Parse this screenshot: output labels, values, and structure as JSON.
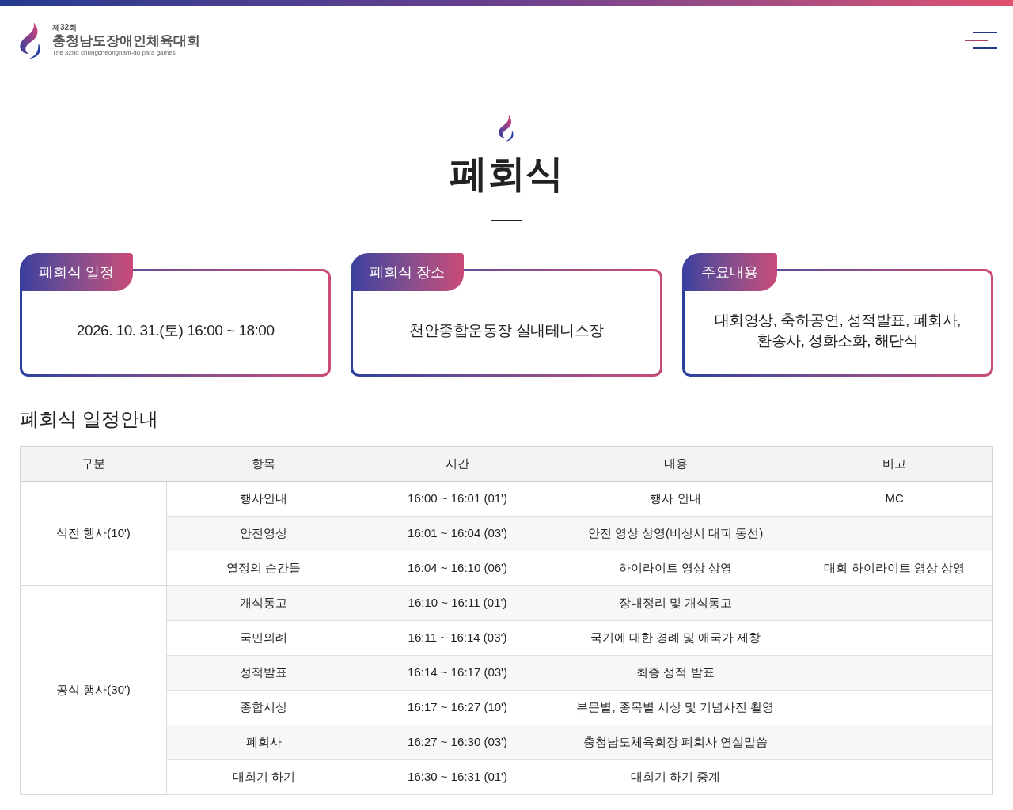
{
  "header": {
    "logo": {
      "edition": "제32회",
      "name": "충청남도장애인체육대회",
      "english": "The 32nd chungcheongnam-do para games"
    }
  },
  "page_title": "폐회식",
  "info_cards": [
    {
      "label": "폐회식 일정",
      "text": "2026. 10. 31.(토) 16:00 ~ 18:00"
    },
    {
      "label": "폐회식 장소",
      "text": "천안종합운동장 실내테니스장"
    },
    {
      "label": "주요내용",
      "text": "대회영상, 축하공연, 성적발표, 폐회사, 환송사, 성화소화, 해단식"
    }
  ],
  "schedule": {
    "title": "폐회식 일정안내",
    "columns": [
      "구분",
      "항목",
      "시간",
      "내용",
      "비고"
    ],
    "groups": [
      {
        "name": "식전 행사(10')",
        "rows": [
          {
            "item": "행사안내",
            "time": "16:00 ~ 16:01 (01')",
            "content": "행사 안내",
            "note": "MC"
          },
          {
            "item": "안전영상",
            "time": "16:01 ~ 16:04 (03')",
            "content": "안전 영상 상영(비상시 대피 동선)"
          },
          {
            "item": "열정의 순간들",
            "time": "16:04 ~ 16:10 (06')",
            "content": "하이라이트 영상 상영",
            "note": "대회 하이라이트 영상 상영"
          }
        ]
      },
      {
        "name": "공식 행사(30')",
        "rows": [
          {
            "item": "개식통고",
            "time": "16:10 ~ 16:11 (01')",
            "content": "장내정리 및 개식통고"
          },
          {
            "item": "국민의례",
            "time": "16:11 ~ 16:14 (03')",
            "content": "국기에 대한 경례 및 애국가 제창"
          },
          {
            "item": "성적발표",
            "time": "16:14 ~ 16:17 (03')",
            "content": "최종 성적 발표"
          },
          {
            "item": "종합시상",
            "time": "16:17 ~ 16:27 (10')",
            "content": "부문별, 종목별 시상 및 기념사진 촬영"
          },
          {
            "item": "폐회사",
            "time": "16:27 ~ 16:30 (03')",
            "content": "충청남도체육회장 폐회사 연설말씀"
          },
          {
            "item": "대회기 하기",
            "time": "16:30 ~ 16:31 (01')",
            "content": "대회기 하기 중계"
          }
        ]
      }
    ]
  }
}
